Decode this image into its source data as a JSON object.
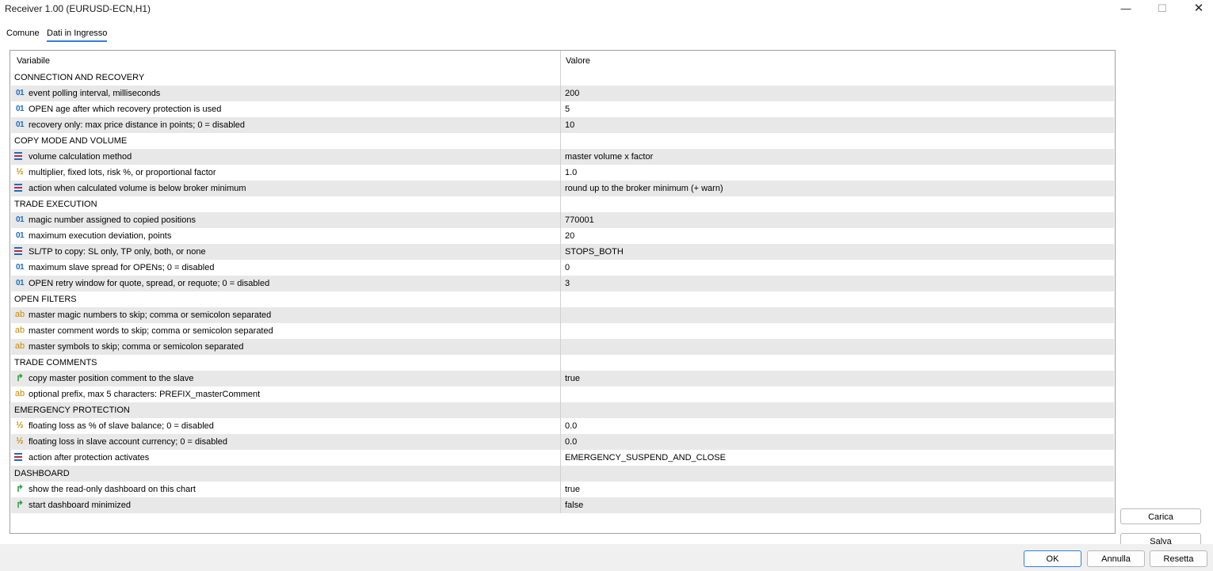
{
  "window": {
    "title": "Receiver 1.00 (EURUSD-ECN,H1)",
    "controls": {
      "minimize": "—",
      "maximize": "☐",
      "close": "✕"
    }
  },
  "tabs": [
    {
      "label": "Comune",
      "active": false
    },
    {
      "label": "Dati in Ingresso",
      "active": true
    }
  ],
  "grid": {
    "headers": {
      "variable": "Variabile",
      "value": "Valore"
    },
    "rows": [
      {
        "kind": "group",
        "label": "CONNECTION AND RECOVERY"
      },
      {
        "kind": "param",
        "type": "int",
        "label": "event polling interval, milliseconds",
        "value": "200"
      },
      {
        "kind": "param",
        "type": "int",
        "label": "OPEN age after which recovery protection is used",
        "value": "5"
      },
      {
        "kind": "param",
        "type": "int",
        "label": "recovery only: max price distance in points; 0 = disabled",
        "value": "10"
      },
      {
        "kind": "group",
        "label": "COPY MODE AND VOLUME"
      },
      {
        "kind": "param",
        "type": "enum",
        "label": "volume calculation method",
        "value": "master volume x factor"
      },
      {
        "kind": "param",
        "type": "double",
        "label": "multiplier, fixed lots, risk %, or proportional factor",
        "value": "1.0"
      },
      {
        "kind": "param",
        "type": "enum",
        "label": "action when calculated volume is below broker minimum",
        "value": "round up to the broker minimum (+ warn)"
      },
      {
        "kind": "group",
        "label": "TRADE EXECUTION"
      },
      {
        "kind": "param",
        "type": "int",
        "label": "magic number assigned to copied positions",
        "value": "770001"
      },
      {
        "kind": "param",
        "type": "int",
        "label": "maximum execution deviation, points",
        "value": "20"
      },
      {
        "kind": "param",
        "type": "enum",
        "label": "SL/TP to copy: SL only, TP only, both, or none",
        "value": "STOPS_BOTH"
      },
      {
        "kind": "param",
        "type": "int",
        "label": "maximum slave spread for OPENs; 0 = disabled",
        "value": "0"
      },
      {
        "kind": "param",
        "type": "int",
        "label": "OPEN retry window for quote, spread, or requote; 0 = disabled",
        "value": "3"
      },
      {
        "kind": "group",
        "label": "OPEN FILTERS"
      },
      {
        "kind": "param",
        "type": "string",
        "label": "master magic numbers to skip; comma or semicolon separated",
        "value": ""
      },
      {
        "kind": "param",
        "type": "string",
        "label": "master comment words to skip; comma or semicolon separated",
        "value": ""
      },
      {
        "kind": "param",
        "type": "string",
        "label": "master symbols to skip; comma or semicolon separated",
        "value": ""
      },
      {
        "kind": "group",
        "label": "TRADE COMMENTS"
      },
      {
        "kind": "param",
        "type": "bool",
        "label": "copy master position comment to the slave",
        "value": "true"
      },
      {
        "kind": "param",
        "type": "string",
        "label": "optional prefix, max 5 characters: PREFIX_masterComment",
        "value": ""
      },
      {
        "kind": "group",
        "label": "EMERGENCY PROTECTION"
      },
      {
        "kind": "param",
        "type": "double",
        "label": "floating loss as % of slave balance; 0 = disabled",
        "value": "0.0"
      },
      {
        "kind": "param",
        "type": "double",
        "label": "floating loss in slave account currency; 0 = disabled",
        "value": "0.0"
      },
      {
        "kind": "param",
        "type": "enum",
        "label": "action after protection activates",
        "value": "EMERGENCY_SUSPEND_AND_CLOSE"
      },
      {
        "kind": "group",
        "label": "DASHBOARD"
      },
      {
        "kind": "param",
        "type": "bool",
        "label": "show the read-only dashboard on this chart",
        "value": "true"
      },
      {
        "kind": "param",
        "type": "bool",
        "label": "start dashboard minimized",
        "value": "false"
      }
    ]
  },
  "icons": {
    "int": "01",
    "double": "½",
    "string": "ab",
    "bool": "↱"
  },
  "side_buttons": {
    "load": "Carica",
    "save": "Salva"
  },
  "footer": {
    "ok": "OK",
    "cancel": "Annulla",
    "reset": "Resetta"
  },
  "colors": {
    "accent": "#2f7fd6",
    "row_shade": "#e8e8e8",
    "int_icon": "#1a6dc7",
    "double_icon": "#c88a00",
    "bool_icon": "#2f9e3d"
  }
}
